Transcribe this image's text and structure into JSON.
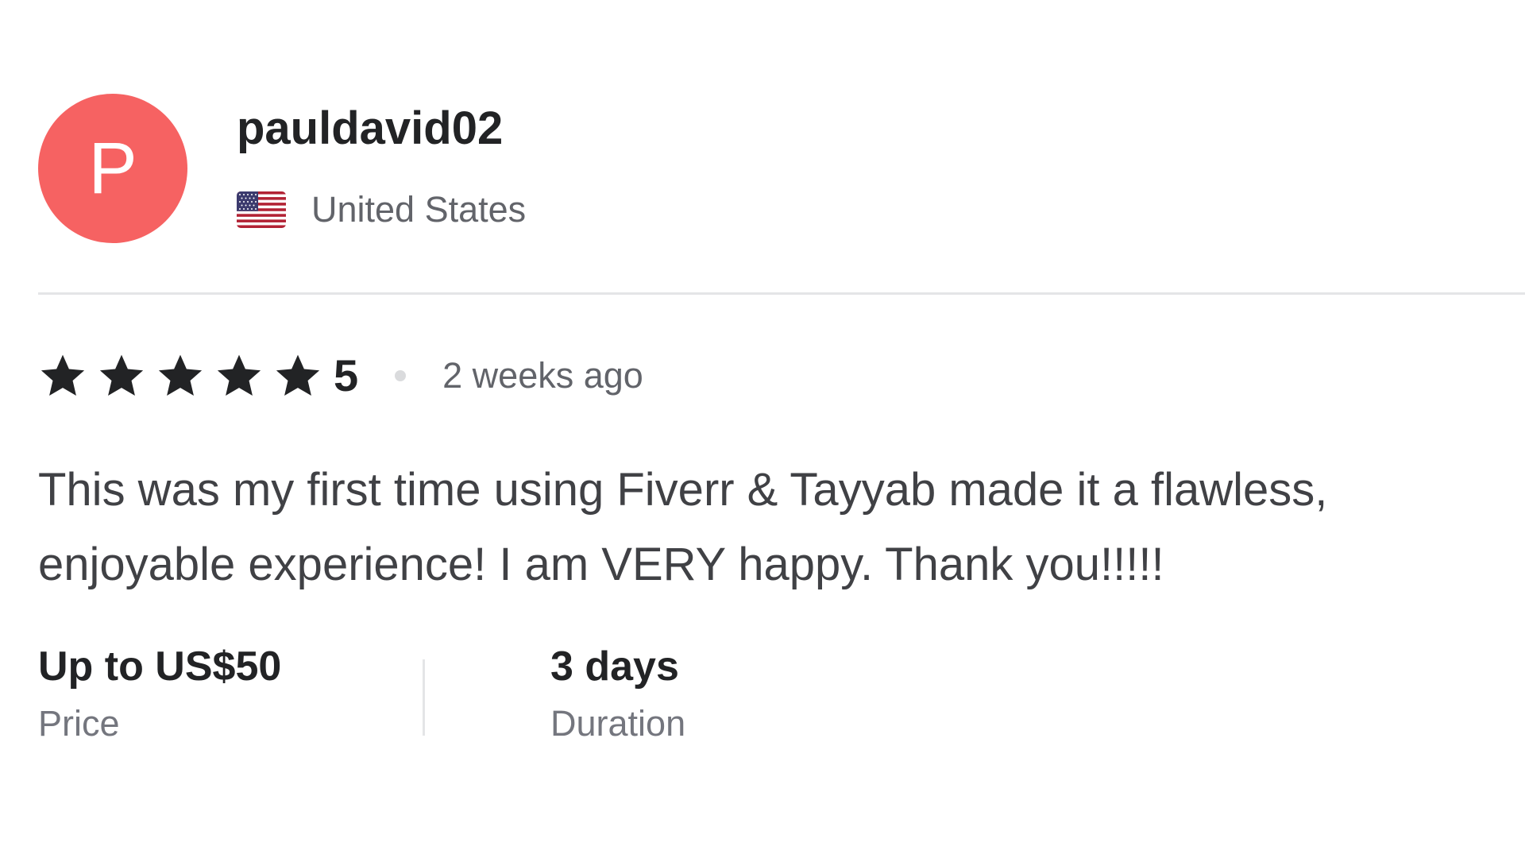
{
  "reviewer": {
    "initial": "P",
    "avatar_color": "#f66262",
    "username": "pauldavid02",
    "country": "United States",
    "flag_icon": "us-flag-icon"
  },
  "rating": {
    "stars": 5,
    "max_stars": 5,
    "value": "5",
    "star_color": "#222325",
    "time_ago": "2 weeks ago"
  },
  "review": {
    "text": "This was my first time using Fiverr & Tayyab made it a flawless, enjoyable experience! I am VERY happy. Thank you!!!!!"
  },
  "details": {
    "price": {
      "value": "Up to US$50",
      "label": "Price"
    },
    "duration": {
      "value": "3 days",
      "label": "Duration"
    }
  }
}
